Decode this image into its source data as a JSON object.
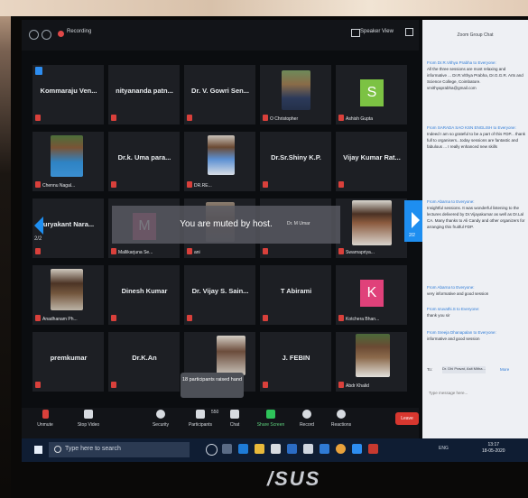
{
  "top_bar": {
    "recording_label": "Recording",
    "speaker_view_label": "Speaker View"
  },
  "tiles": [
    {
      "name": "Kommaraju Ven...",
      "label": ""
    },
    {
      "name": "nityananda patn...",
      "label": ""
    },
    {
      "name": "Dr. V. Gowri Sen...",
      "label": ""
    },
    {
      "name": "",
      "label": "O Christopher"
    },
    {
      "name": "",
      "label": "Ashish Gupta",
      "avatar": "S",
      "avatar_color": "#7cc243"
    },
    {
      "name": "",
      "label": "Chennu Nagal..."
    },
    {
      "name": "Dr.k. Uma para...",
      "label": ""
    },
    {
      "name": "",
      "label": "DR.RE..."
    },
    {
      "name": "Dr.Sr.Shiny K.P.",
      "label": ""
    },
    {
      "name": "Vijay Kumar Rat...",
      "label": ""
    },
    {
      "name": "uryakant Nara...",
      "label": ""
    },
    {
      "name": "",
      "label": "Mallikarjuna Se...",
      "avatar": "M",
      "avatar_color": "#b03c6b"
    },
    {
      "name": "",
      "label": "ani"
    },
    {
      "name": "",
      "label": ""
    },
    {
      "name": "",
      "label": "Swarnapriya..."
    },
    {
      "name": "",
      "label": "Anadhanam Ph..."
    },
    {
      "name": "Dinesh Kumar",
      "label": ""
    },
    {
      "name": "Dr. Vijay S. Sain...",
      "label": ""
    },
    {
      "name": "T Abirami",
      "label": ""
    },
    {
      "name": "",
      "label": "Kotchera Bhan...",
      "avatar": "K",
      "avatar_color": "#e0417a"
    },
    {
      "name": "premkumar",
      "label": ""
    },
    {
      "name": "Dr.K.An",
      "label": ""
    },
    {
      "name": "",
      "label": ""
    },
    {
      "name": "J. FEBIN",
      "label": ""
    },
    {
      "name": "",
      "label": "Abdr Khalid"
    }
  ],
  "pagination": {
    "left_label": "2/2",
    "right_label": "2/2"
  },
  "banner": {
    "muted_text": "You are muted by host.",
    "muted_by": "Dr. M Umar"
  },
  "raised_hands": {
    "text": "18 participants raised hand"
  },
  "toolbar": {
    "unmute": "Unmute",
    "stop_video": "Stop Video",
    "security": "Security",
    "participants": "Participants",
    "participants_count": "550",
    "chat": "Chat",
    "share_screen": "Share Screen",
    "record": "Record",
    "reactions": "Reactions",
    "leave": "Leave"
  },
  "chat": {
    "title": "Zoom Group Chat",
    "messages": [
      {
        "from": "From Dr.R.Vithya Prabha to Everyone:",
        "text": "All the three sessions are most relaxing and informative ... Dr.R.Vithya Prabha, Dr.G.G.R. Arts and Science College, Coimbatore. vrvithyaprabha@gmail.com"
      },
      {
        "from": "From SARADA SAO KSN ENGLISH to Everyone:",
        "text": "Indeed I am so grateful to be a part of this FDP... thank full to organisers...today sessions are fantastic and fabulous ... I really enhanced new skills"
      },
      {
        "from": "From Abarna to Everyone:",
        "text": "Insightful sessions. It was wonderful listening to the lectures delivered by Dr.Vijayakumar as well as Dr.Lal CA. Many thanks to Ali Candy and other organizers for arranging this fruitful FDP."
      },
      {
        "from": "From Abarna to Everyone:",
        "text": "very informative and good session"
      },
      {
        "from": "From sruvathi.S to Everyone:",
        "text": "thank you sir"
      },
      {
        "from": "From Sreeja Dhanapalan to Everyone:",
        "text": "informative and good session"
      }
    ],
    "to_label": "To:",
    "to_value": "Dr. Dhi Pravat, Asit Mitha...",
    "more_label": "More",
    "input_placeholder": "Type message here..."
  },
  "taskbar": {
    "search_placeholder": "Type here to search",
    "time": "13:17",
    "date": "18-05-2020",
    "lang": "ENG"
  },
  "brand": {
    "logo_text": "/SUS"
  }
}
